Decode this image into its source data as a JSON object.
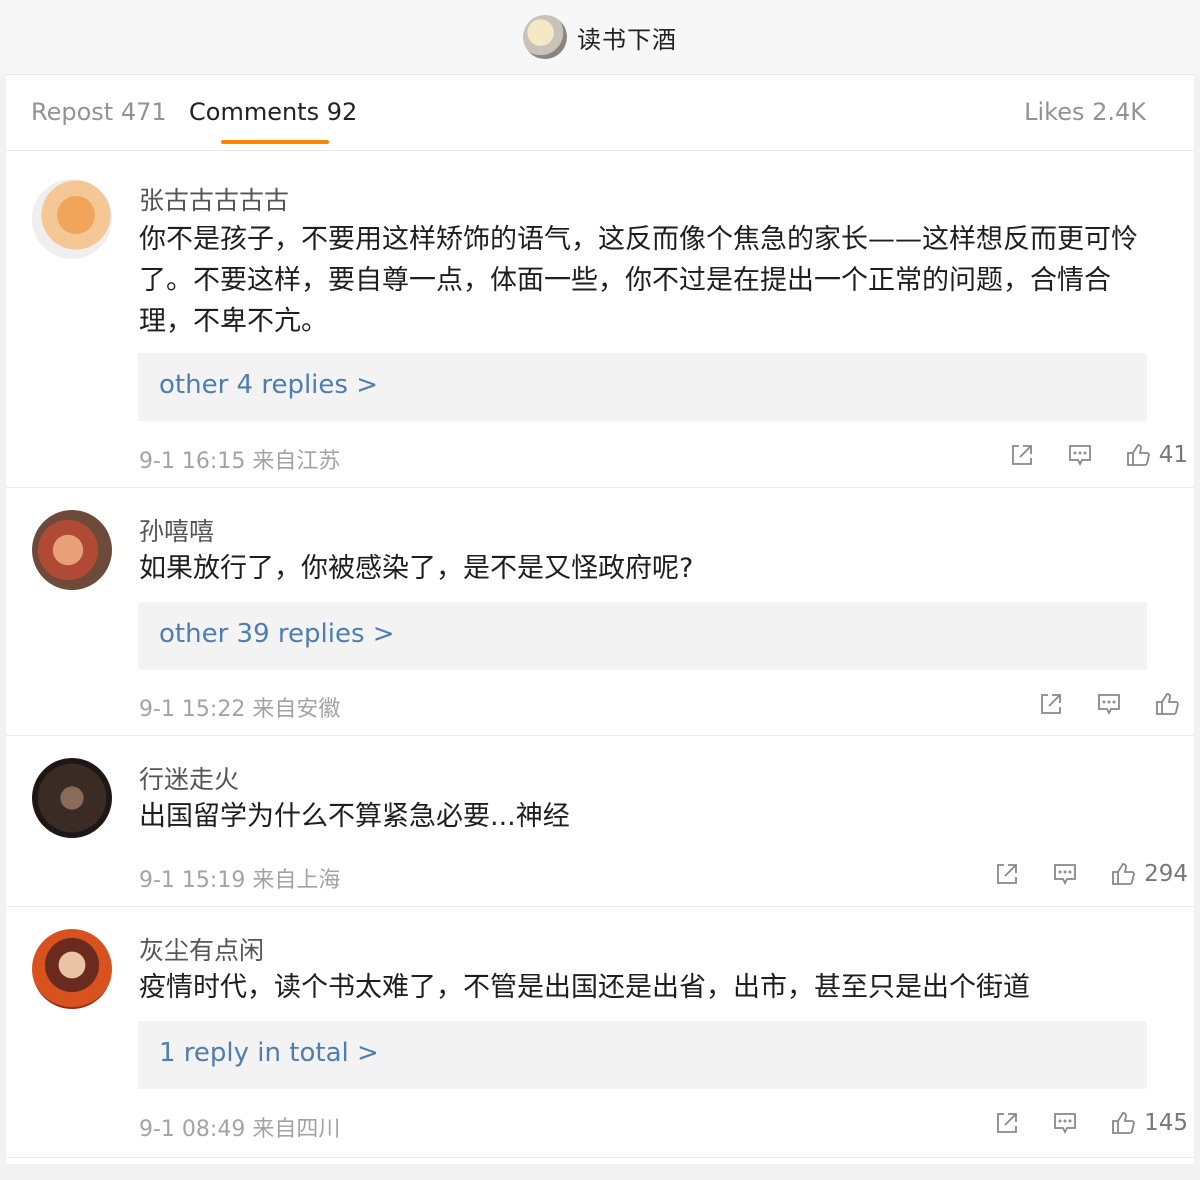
{
  "header": {
    "title": "读书下酒",
    "avatar_icon": "tom-cat-avatar"
  },
  "tabs": {
    "repost": "Repost 471",
    "comments": "Comments 92",
    "likes": "Likes 2.4K",
    "accent_color": "#ff8200"
  },
  "comments": [
    {
      "name": "张古古古古古",
      "text": "你不是孩子，不要用这样矫饰的语气，这反而像个焦急的家长——这样想反而更可怜了。不要这样，要自尊一点，体面一些，你不过是在提出一个正常的问题，合情合理，不卑不亢。",
      "replies": "other 4 replies >",
      "time": "9-1 16:15 来自江苏",
      "likes": "41"
    },
    {
      "name": "孙嘻嘻",
      "text": "如果放行了，你被感染了，是不是又怪政府呢?",
      "replies": "other 39 replies >",
      "time": "9-1 15:22 来自安徽",
      "likes": ""
    },
    {
      "name": "行迷走火",
      "text": "出国留学为什么不算紧急必要...神经",
      "replies": "",
      "time": "9-1 15:19 来自上海",
      "likes": "294"
    },
    {
      "name": "灰尘有点闲",
      "text": "疫情时代，读个书太难了，不管是出国还是出省，出市，甚至只是出个街道",
      "replies": "1 reply in total >",
      "time": "9-1 08:49 来自四川",
      "likes": "145"
    }
  ],
  "icons": [
    "share-icon",
    "comment-icon",
    "like-icon"
  ]
}
